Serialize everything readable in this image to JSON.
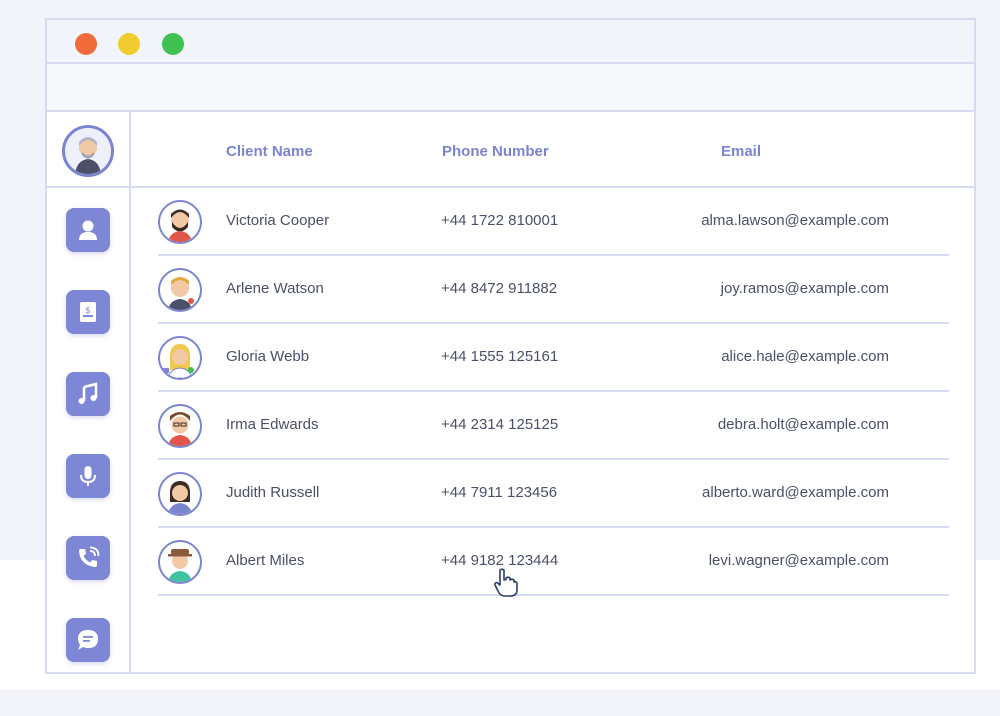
{
  "window": {
    "controls": [
      {
        "name": "close",
        "color": "#f26b3a"
      },
      {
        "name": "minimize",
        "color": "#f2cc2f"
      },
      {
        "name": "maximize",
        "color": "#3fc24f"
      }
    ]
  },
  "sidebar": {
    "items": [
      {
        "icon": "user-icon"
      },
      {
        "icon": "document-icon"
      },
      {
        "icon": "music-note-icon"
      },
      {
        "icon": "microphone-icon"
      },
      {
        "icon": "phone-call-icon"
      },
      {
        "icon": "chat-bubble-icon"
      }
    ]
  },
  "table": {
    "headers": {
      "name": "Client Name",
      "phone": "Phone Number",
      "email": "Email"
    },
    "rows": [
      {
        "name": "Victoria Cooper",
        "phone": "+44 1722 810001",
        "email": "alma.lawson@example.com"
      },
      {
        "name": "Arlene Watson",
        "phone": "+44 8472 911882",
        "email": "joy.ramos@example.com"
      },
      {
        "name": "Gloria Webb",
        "phone": "+44 1555 125161",
        "email": "alice.hale@example.com"
      },
      {
        "name": "Irma Edwards",
        "phone": "+44 2314 125125",
        "email": "debra.holt@example.com"
      },
      {
        "name": "Judith Russell",
        "phone": "+44 7911 123456",
        "email": "alberto.ward@example.com"
      },
      {
        "name": "Albert Miles",
        "phone": "+44 9182 123444",
        "email": "levi.wagner@example.com"
      }
    ]
  },
  "colors": {
    "accent": "#7b84cf",
    "border": "#d6dbf0",
    "text": "#4a5068"
  }
}
